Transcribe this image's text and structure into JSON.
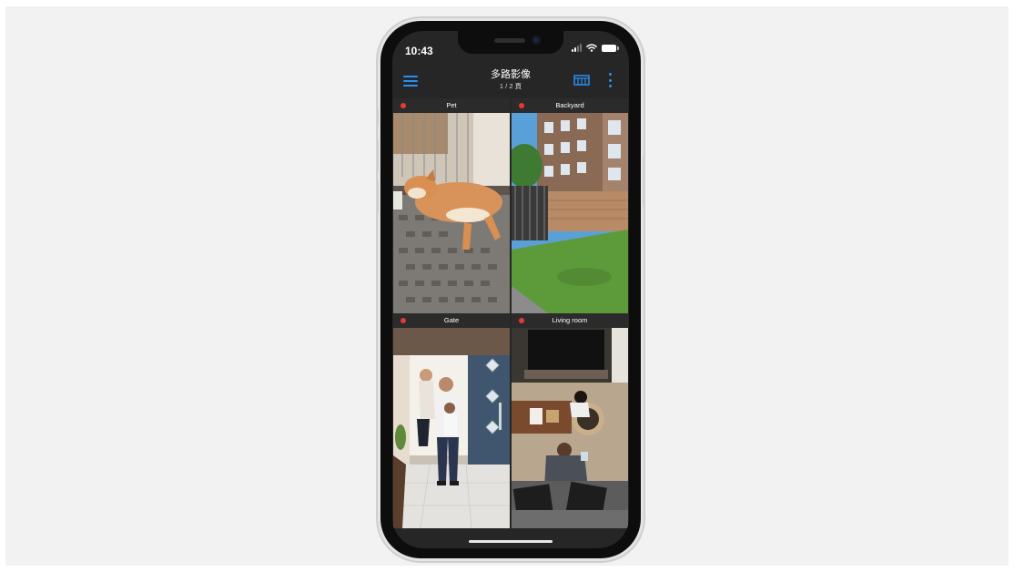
{
  "status_bar": {
    "time": "10:43"
  },
  "app_bar": {
    "title": "多路影像",
    "page_indicator": "1 / 2 頁"
  },
  "colors": {
    "accent": "#2a8ff0",
    "recording": "#e53935",
    "header_bg": "#2b2b2b",
    "screen_bg": "#262626"
  },
  "icons": {
    "menu": "hamburger-menu-icon",
    "layout": "grid-layout-icon",
    "more": "more-vertical-icon"
  },
  "cameras": [
    {
      "name": "Pet",
      "recording": true
    },
    {
      "name": "Backyard",
      "recording": true
    },
    {
      "name": "Gate",
      "recording": true
    },
    {
      "name": "Living room",
      "recording": true
    }
  ]
}
